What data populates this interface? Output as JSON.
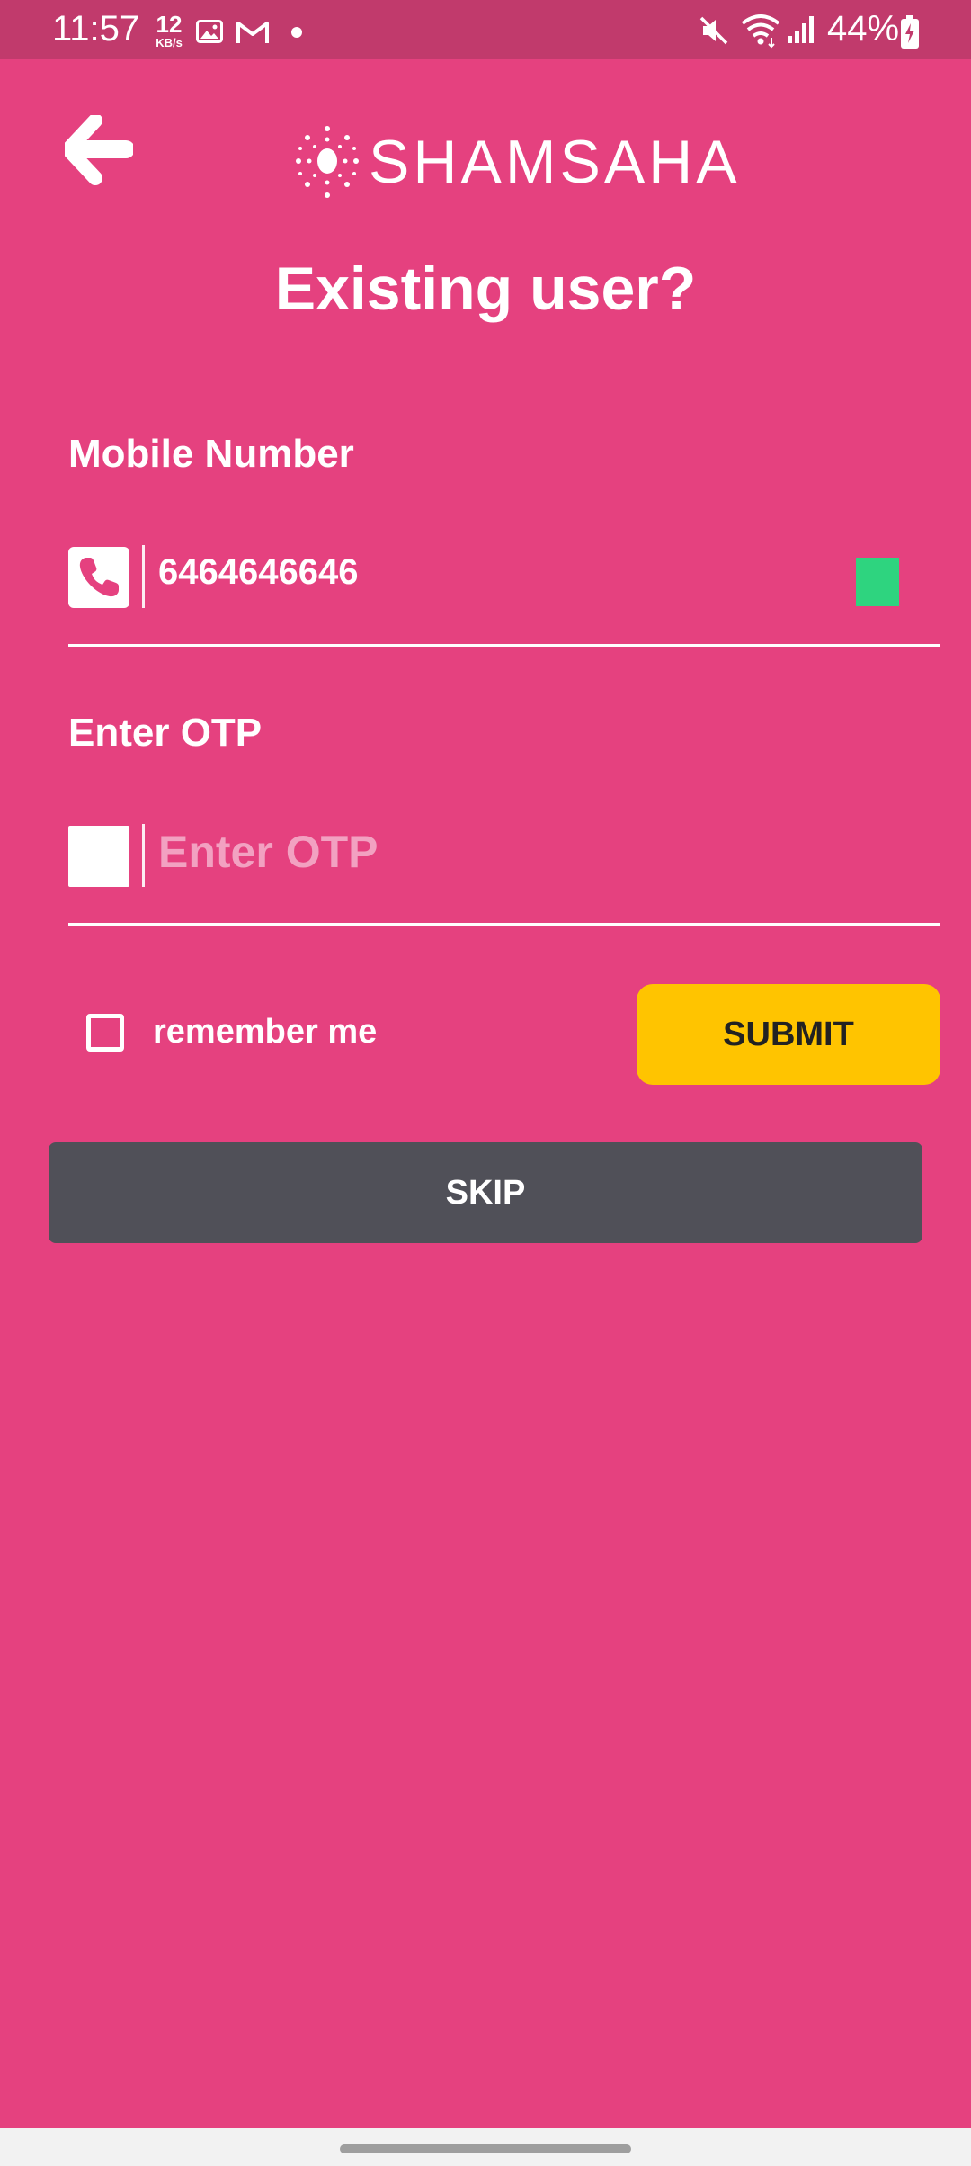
{
  "status_bar": {
    "time": "11:57",
    "net_speed_value": "12",
    "net_speed_unit": "KB/s",
    "battery_text": "44%",
    "icons": [
      "image-icon",
      "gmail-icon",
      "notification-dot",
      "mute-icon",
      "wifi-icon",
      "signal-icon",
      "battery-charging-icon"
    ]
  },
  "header": {
    "back_icon": "arrow-left-icon",
    "logo_text": "SHAMSAHA"
  },
  "page": {
    "title": "Existing user?"
  },
  "mobile": {
    "label": "Mobile Number",
    "icon": "phone-icon",
    "value": "6464646646"
  },
  "otp": {
    "label": "Enter OTP",
    "placeholder": "Enter OTP",
    "value": ""
  },
  "remember": {
    "label": "remember me",
    "checked": false
  },
  "buttons": {
    "submit": "SUBMIT",
    "skip": "SKIP"
  },
  "colors": {
    "background": "#e5417f",
    "status_bar": "#c13a6c",
    "submit": "#ffc400",
    "skip": "#505058",
    "indicator": "#2ed47f"
  }
}
